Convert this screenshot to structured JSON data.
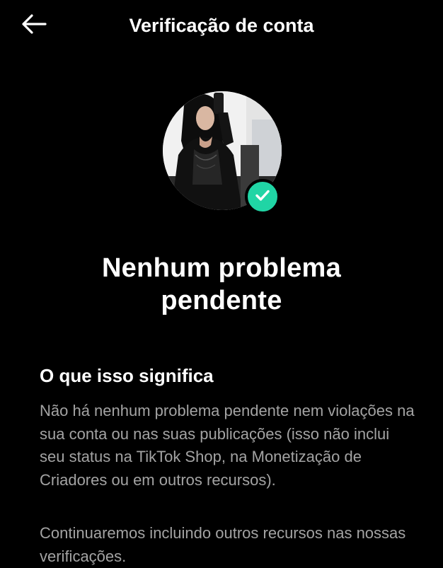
{
  "header": {
    "title": "Verificação de conta",
    "back_icon": "arrow-left-icon"
  },
  "profile": {
    "avatar_alt": "profile-photo",
    "badge_icon": "check-icon",
    "badge_color": "#20d5a5"
  },
  "status": {
    "title": "Nenhum problema pendente"
  },
  "info": {
    "heading": "O que isso significa",
    "paragraph_1": "Não há nenhum problema pendente nem violações na sua conta ou nas suas publicações (isso não inclui seu status na TikTok Shop, na Monetização de Criadores ou em outros recursos).",
    "paragraph_2": "Continuaremos incluindo outros recursos nas nossas verificações."
  },
  "colors": {
    "background": "#000000",
    "text_primary": "#ffffff",
    "text_secondary": "#a3a3a3"
  }
}
